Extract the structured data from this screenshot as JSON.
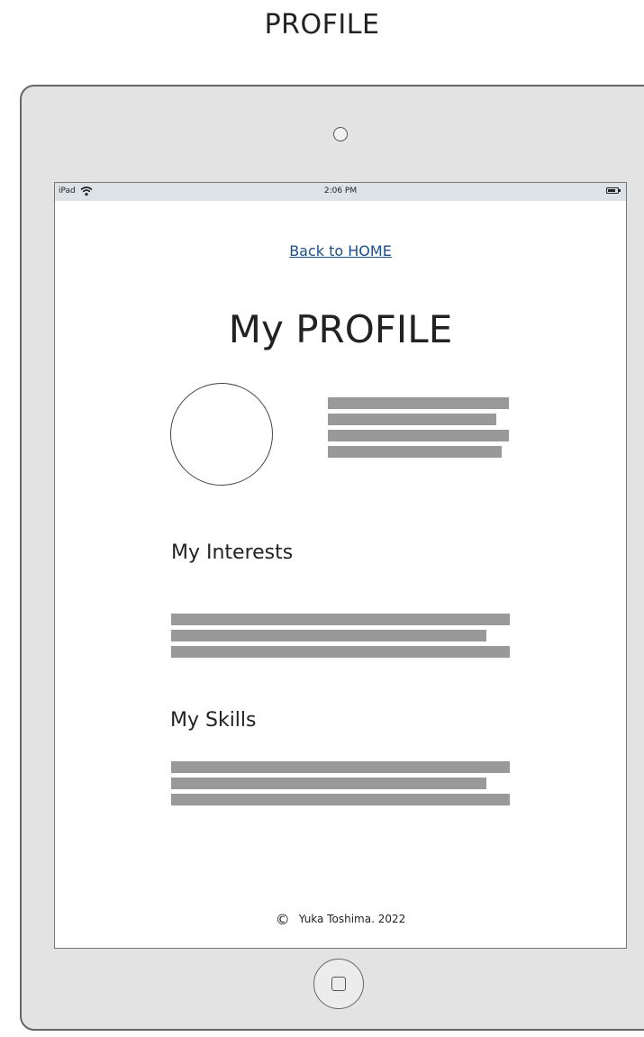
{
  "wireframe": {
    "title": "PROFILE"
  },
  "status_bar": {
    "device": "iPad",
    "time": "2:06 PM",
    "icons": [
      "wifi-icon",
      "battery-icon"
    ]
  },
  "nav": {
    "back_link": "Back to HOME"
  },
  "profile": {
    "heading": "My PROFILE",
    "avatar_icon": "avatar-circle"
  },
  "interests": {
    "heading": "My Interests"
  },
  "skills": {
    "heading": "My Skills"
  },
  "footer": {
    "copyright_symbol": "©",
    "text": "Yuka Toshima. 2022"
  },
  "colors": {
    "link": "#1a4f8c",
    "placeholder_line": "#999999",
    "status_bar": "#dde2e6",
    "device_frame": "#e3e3e3"
  }
}
